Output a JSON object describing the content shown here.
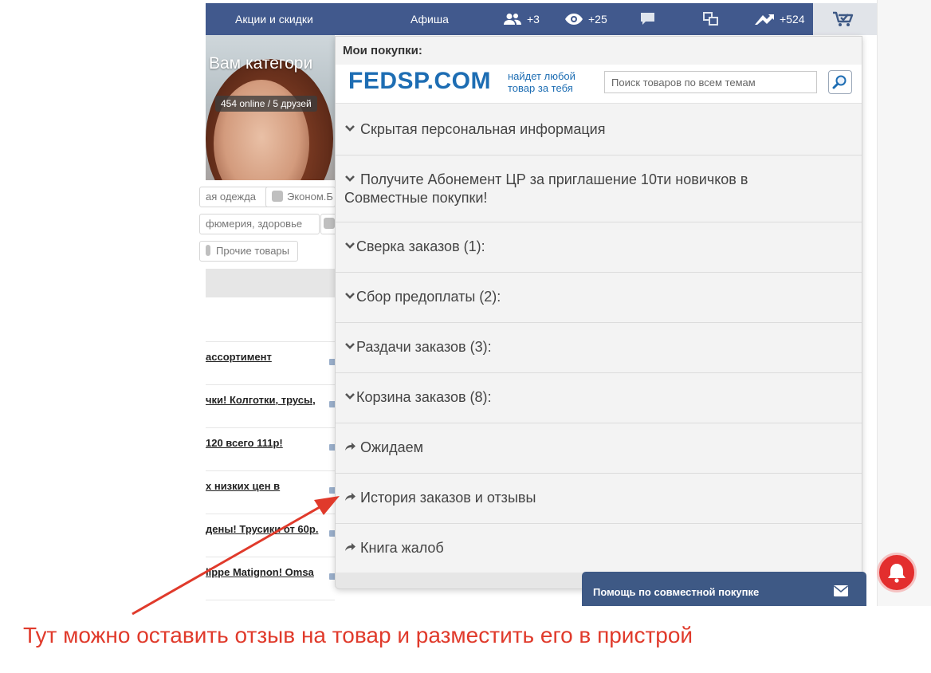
{
  "nav": {
    "promo_label": "Акции и скидки",
    "afisha_label": "Афиша",
    "friends_count": "+3",
    "views_count": "+25",
    "rating_count": "+524"
  },
  "banner": {
    "title": "Вам категори",
    "online": "454 online / 5 друзей"
  },
  "categories": [
    {
      "label": "ая одежда"
    },
    {
      "label": "Эконом.Б"
    },
    {
      "label": "фюмерия, здоровье"
    },
    {
      "label": "Прочие товары"
    }
  ],
  "bg_links": [
    {
      "text": "ассортимент"
    },
    {
      "text": "чки! Колготки, трусы,"
    },
    {
      "text": " 120 всего 111р!"
    },
    {
      "text": "х низких цен в"
    },
    {
      "text": "дены! Трусики от 60р."
    },
    {
      "text": "lippe Matignon! Omsa"
    }
  ],
  "dropdown": {
    "title": "Мои покупки:",
    "logo_main": "FEDSP.COM",
    "logo_tag_line1": "найдет любой",
    "logo_tag_line2": "товар за тебя",
    "search_placeholder": "Поиск товаров по всем темам",
    "items": [
      {
        "label": "Скрытая персональная информация",
        "icon": "chevron-down-icon"
      },
      {
        "label": "Получите Абонемент ЦР за приглашение 10ти новичков в Совместные покупки!",
        "icon": "chevron-down-icon"
      },
      {
        "label": "Сверка заказов (1):",
        "icon": "chevron-down-icon"
      },
      {
        "label": "Сбор предоплаты (2):",
        "icon": "chevron-down-icon"
      },
      {
        "label": "Раздачи заказов (3):",
        "icon": "chevron-down-icon"
      },
      {
        "label": "Корзина заказов (8):",
        "icon": "chevron-down-icon"
      },
      {
        "label": "Ожидаем",
        "icon": "share-arrow-icon"
      },
      {
        "label": "История заказов и отзывы",
        "icon": "share-arrow-icon"
      },
      {
        "label": "Книга жалоб",
        "icon": "share-arrow-icon"
      }
    ]
  },
  "help": {
    "label": "Помощь по совместной покупке"
  },
  "annotation": {
    "text": "Тут можно оставить отзыв на товар и разместить его в пристрой",
    "color": "#e03a2b"
  },
  "colors": {
    "nav_bg": "#41598d",
    "logo_blue": "#1d6db3",
    "help_bg": "#3e5985",
    "bell_red": "#e32e2e"
  }
}
